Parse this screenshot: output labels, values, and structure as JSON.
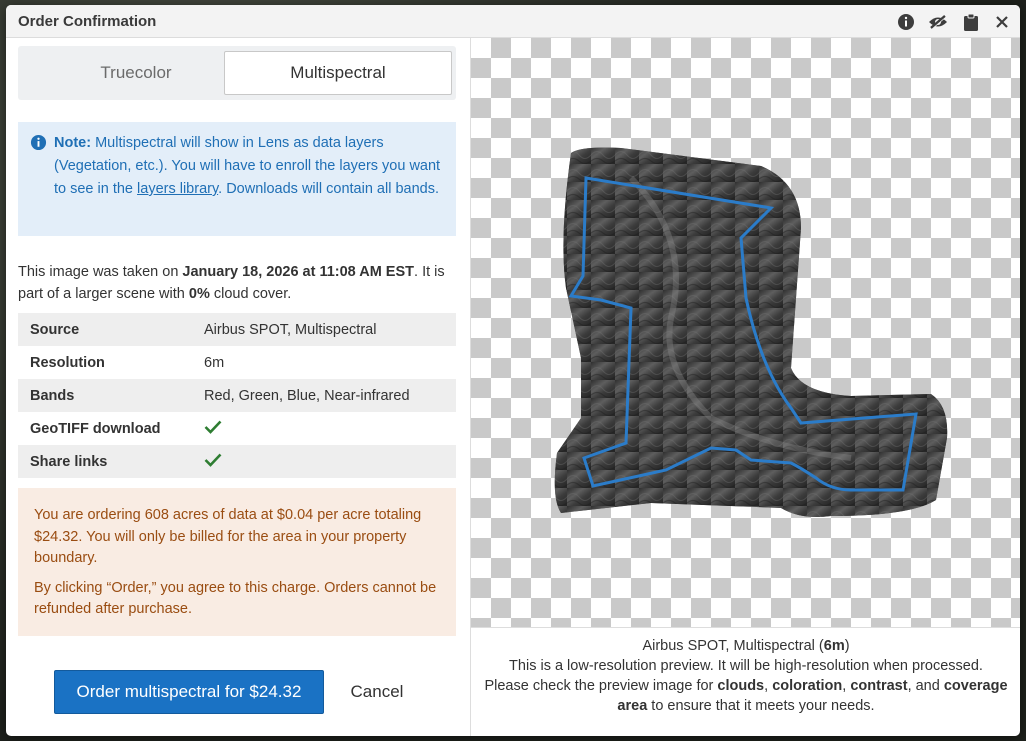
{
  "dialog": {
    "title": "Order Confirmation",
    "icons": [
      "info-circle-icon",
      "eye-slash-icon",
      "clipboard-icon",
      "close-icon"
    ]
  },
  "toggle": {
    "options": [
      "Truecolor",
      "Multispectral"
    ],
    "selected": "Multispectral"
  },
  "note": {
    "label": "Note:",
    "text1": " Multispectral will show in Lens as data layers (Vegetation, etc.). You will have to enroll the layers you want to see in the ",
    "link": "layers library",
    "text2": ". Downloads will contain all bands."
  },
  "capture": {
    "prefix": "This image was taken on ",
    "date": "January 18, 2026 at 11:08 AM EST",
    "middle": ". It is part of a larger scene with ",
    "cloud": "0%",
    "suffix": " cloud cover."
  },
  "specs": [
    {
      "key": "Source",
      "value": "Airbus SPOT, Multispectral"
    },
    {
      "key": "Resolution",
      "value": "6m"
    },
    {
      "key": "Bands",
      "value": "Red, Green, Blue, Near-infrared"
    },
    {
      "key": "GeoTIFF download",
      "value": "✓"
    },
    {
      "key": "Share links",
      "value": "✓"
    }
  ],
  "billing": {
    "line1": "You are ordering 608 acres of data at $0.04 per acre totaling $24.32. You will only be billed for the area in your property boundary.",
    "line2": "By clicking “Order,” you agree to this charge. Orders cannot be refunded after purchase."
  },
  "actions": {
    "order": "Order multispectral for $24.32",
    "cancel": "Cancel"
  },
  "preview": {
    "source": "Airbus SPOT, Multispectral (",
    "resolution": "6m",
    "source_end": ")",
    "line2": "This is a low-resolution preview. It will be high-resolution when processed.",
    "line3_prefix": "Please check the preview image for ",
    "k1": "clouds",
    "k2": "coloration",
    "k3": "contrast",
    "and": ", and ",
    "k4": "coverage area",
    "line3_suffix": " to ensure that it meets your needs."
  },
  "colors": {
    "primary": "#1a72c4",
    "check": "#2e7d32",
    "note_bg": "#e3eef9",
    "warn_bg": "#f9ece3",
    "boundary": "#2b7cc9"
  }
}
